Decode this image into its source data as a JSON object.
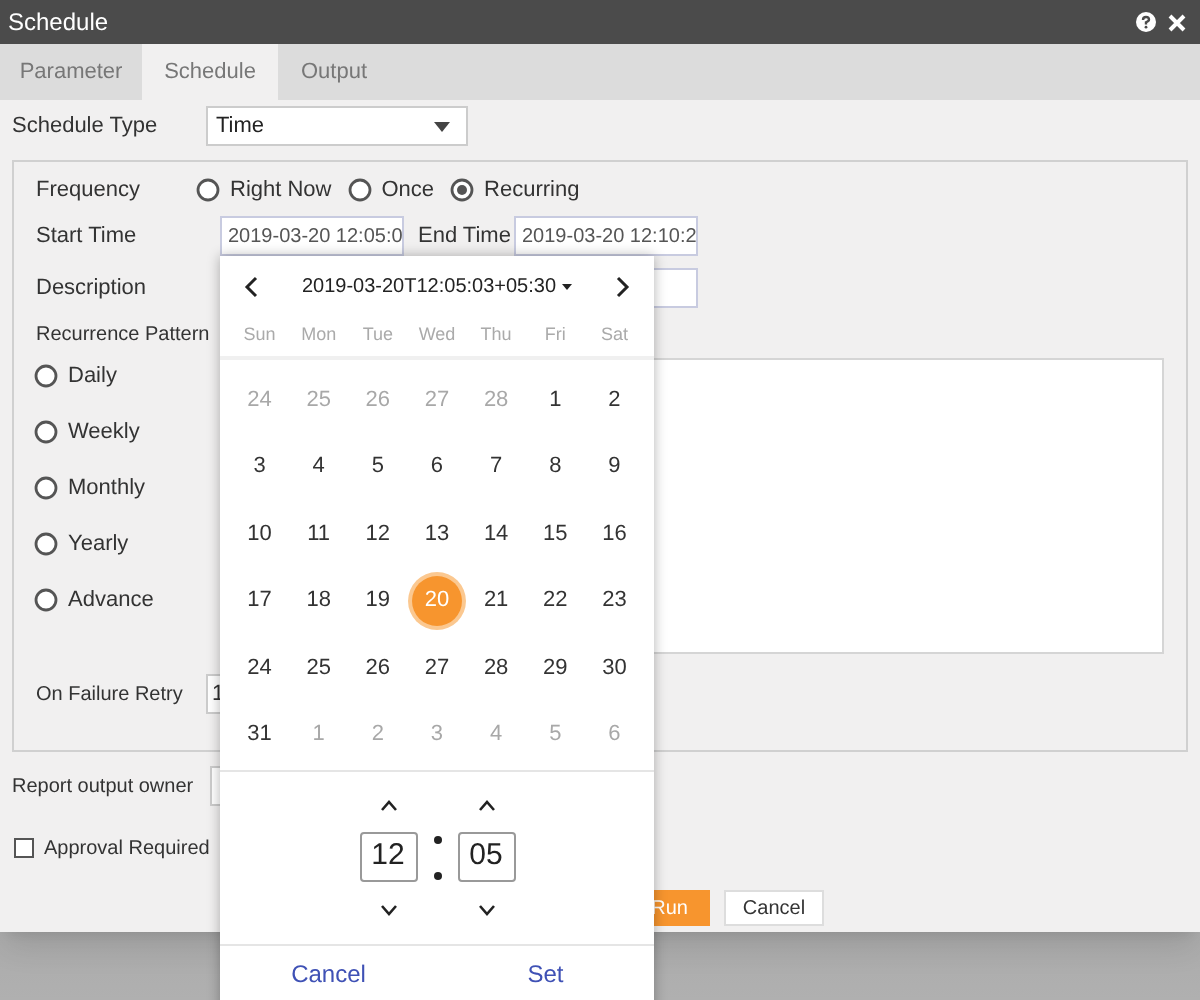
{
  "window": {
    "title": "Schedule"
  },
  "tabs": [
    {
      "label": "Parameter",
      "selected": false
    },
    {
      "label": "Schedule",
      "selected": true
    },
    {
      "label": "Output",
      "selected": false
    }
  ],
  "schedule_type": {
    "label": "Schedule Type",
    "value": "Time"
  },
  "frequency": {
    "label": "Frequency",
    "options": [
      {
        "label": "Right Now",
        "selected": false
      },
      {
        "label": "Once",
        "selected": false
      },
      {
        "label": "Recurring",
        "selected": true
      }
    ]
  },
  "start_time": {
    "label": "Start Time",
    "value": "2019-03-20 12:05:0"
  },
  "end_time": {
    "label": "End Time",
    "value": "2019-03-20 12:10:2"
  },
  "description": {
    "label": "Description"
  },
  "recurrence_pattern": {
    "label": "Recurrence Pattern",
    "options": [
      {
        "label": "Daily",
        "selected": false
      },
      {
        "label": "Weekly",
        "selected": false
      },
      {
        "label": "Monthly",
        "selected": false
      },
      {
        "label": "Yearly",
        "selected": false
      },
      {
        "label": "Advance",
        "selected": false
      }
    ]
  },
  "on_failure_retry": {
    "label": "On Failure Retry",
    "value": "1"
  },
  "report_output_owner": {
    "label": "Report output owner"
  },
  "approval_required": {
    "label": "Approval Required",
    "checked": false
  },
  "buttons": [
    "Run",
    "Cancel"
  ],
  "date_picker": {
    "title": "2019-03-20T12:05:03+05:30",
    "weekdays": [
      "Sun",
      "Mon",
      "Tue",
      "Wed",
      "Thu",
      "Fri",
      "Sat"
    ],
    "days": [
      {
        "day": "24",
        "muted": true,
        "selected": false
      },
      {
        "day": "25",
        "muted": true,
        "selected": false
      },
      {
        "day": "26",
        "muted": true,
        "selected": false
      },
      {
        "day": "27",
        "muted": true,
        "selected": false
      },
      {
        "day": "28",
        "muted": true,
        "selected": false
      },
      {
        "day": "1",
        "muted": false,
        "selected": false
      },
      {
        "day": "2",
        "muted": false,
        "selected": false
      },
      {
        "day": "3",
        "muted": false,
        "selected": false
      },
      {
        "day": "4",
        "muted": false,
        "selected": false
      },
      {
        "day": "5",
        "muted": false,
        "selected": false
      },
      {
        "day": "6",
        "muted": false,
        "selected": false
      },
      {
        "day": "7",
        "muted": false,
        "selected": false
      },
      {
        "day": "8",
        "muted": false,
        "selected": false
      },
      {
        "day": "9",
        "muted": false,
        "selected": false
      },
      {
        "day": "10",
        "muted": false,
        "selected": false
      },
      {
        "day": "11",
        "muted": false,
        "selected": false
      },
      {
        "day": "12",
        "muted": false,
        "selected": false
      },
      {
        "day": "13",
        "muted": false,
        "selected": false
      },
      {
        "day": "14",
        "muted": false,
        "selected": false
      },
      {
        "day": "15",
        "muted": false,
        "selected": false
      },
      {
        "day": "16",
        "muted": false,
        "selected": false
      },
      {
        "day": "17",
        "muted": false,
        "selected": false
      },
      {
        "day": "18",
        "muted": false,
        "selected": false
      },
      {
        "day": "19",
        "muted": false,
        "selected": false
      },
      {
        "day": "20",
        "muted": false,
        "selected": true
      },
      {
        "day": "21",
        "muted": false,
        "selected": false
      },
      {
        "day": "22",
        "muted": false,
        "selected": false
      },
      {
        "day": "23",
        "muted": false,
        "selected": false
      },
      {
        "day": "24",
        "muted": false,
        "selected": false
      },
      {
        "day": "25",
        "muted": false,
        "selected": false
      },
      {
        "day": "26",
        "muted": false,
        "selected": false
      },
      {
        "day": "27",
        "muted": false,
        "selected": false
      },
      {
        "day": "28",
        "muted": false,
        "selected": false
      },
      {
        "day": "29",
        "muted": false,
        "selected": false
      },
      {
        "day": "30",
        "muted": false,
        "selected": false
      },
      {
        "day": "31",
        "muted": false,
        "selected": false
      },
      {
        "day": "1",
        "muted": true,
        "selected": false
      },
      {
        "day": "2",
        "muted": true,
        "selected": false
      },
      {
        "day": "3",
        "muted": true,
        "selected": false
      },
      {
        "day": "4",
        "muted": true,
        "selected": false
      },
      {
        "day": "5",
        "muted": true,
        "selected": false
      },
      {
        "day": "6",
        "muted": true,
        "selected": false
      }
    ],
    "hour": "12",
    "minute": "05",
    "actions": [
      "Cancel",
      "Set"
    ]
  }
}
